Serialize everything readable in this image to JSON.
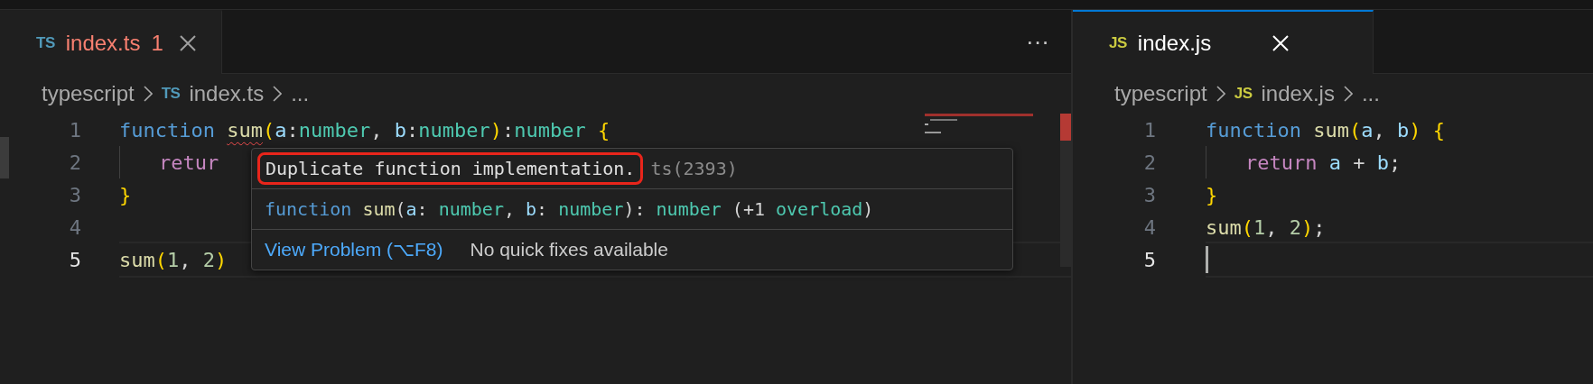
{
  "editor_groups": [
    {
      "focused": false,
      "tabs": [
        {
          "badge": "TS",
          "label": "index.ts",
          "problem_count": "1",
          "has_errors": true,
          "selected": true
        }
      ],
      "more_actions": "···",
      "breadcrumbs": [
        {
          "text": "typescript"
        },
        {
          "text": "index.ts",
          "badge": "TS"
        },
        {
          "text": "..."
        }
      ],
      "lines": [
        {
          "number": "1",
          "current": false,
          "tokens": [
            {
              "text": "function ",
              "kind": "keyword"
            },
            {
              "text": "sum",
              "kind": "function",
              "error": true
            },
            {
              "text": "(",
              "kind": "bracket"
            },
            {
              "text": "a",
              "kind": "param"
            },
            {
              "text": ":",
              "kind": "plain"
            },
            {
              "text": "number",
              "kind": "type"
            },
            {
              "text": ", ",
              "kind": "plain"
            },
            {
              "text": "b",
              "kind": "param"
            },
            {
              "text": ":",
              "kind": "plain"
            },
            {
              "text": "number",
              "kind": "type"
            },
            {
              "text": ")",
              "kind": "bracket"
            },
            {
              "text": ":",
              "kind": "plain"
            },
            {
              "text": "number ",
              "kind": "type"
            },
            {
              "text": "{",
              "kind": "bracket"
            }
          ]
        },
        {
          "number": "2",
          "current": false,
          "indent": true,
          "tokens": [
            {
              "text": "retur",
              "kind": "control"
            }
          ]
        },
        {
          "number": "3",
          "current": false,
          "tokens": [
            {
              "text": "}",
              "kind": "bracket"
            }
          ]
        },
        {
          "number": "4",
          "current": false
        },
        {
          "number": "5",
          "current": true,
          "tokens": [
            {
              "text": "sum",
              "kind": "function"
            },
            {
              "text": "(",
              "kind": "bracket"
            },
            {
              "text": "1",
              "kind": "number"
            },
            {
              "text": ", ",
              "kind": "plain"
            },
            {
              "text": "2",
              "kind": "number"
            },
            {
              "text": ")",
              "kind": "bracket"
            }
          ]
        }
      ],
      "hover": {
        "message": "Duplicate function implementation.",
        "message_highlighted": true,
        "code": "ts(2393)",
        "signature": [
          {
            "text": "function ",
            "kind": "keyword"
          },
          {
            "text": "sum",
            "kind": "function"
          },
          {
            "text": "(",
            "kind": "plain"
          },
          {
            "text": "a",
            "kind": "param"
          },
          {
            "text": ": ",
            "kind": "plain"
          },
          {
            "text": "number",
            "kind": "type"
          },
          {
            "text": ", ",
            "kind": "plain"
          },
          {
            "text": "b",
            "kind": "param"
          },
          {
            "text": ": ",
            "kind": "plain"
          },
          {
            "text": "number",
            "kind": "type"
          },
          {
            "text": "): ",
            "kind": "plain"
          },
          {
            "text": "number",
            "kind": "type"
          },
          {
            "text": " (+1 ",
            "kind": "plain"
          },
          {
            "text": "overload",
            "kind": "type"
          },
          {
            "text": ")",
            "kind": "plain"
          }
        ],
        "action": "View Problem (⌥F8)",
        "note": "No quick fixes available"
      }
    },
    {
      "focused": true,
      "tabs": [
        {
          "badge": "JS",
          "label": "index.js",
          "has_errors": false,
          "selected": true
        }
      ],
      "breadcrumbs": [
        {
          "text": "typescript"
        },
        {
          "text": "index.js",
          "badge": "JS"
        },
        {
          "text": "..."
        }
      ],
      "lines": [
        {
          "number": "1",
          "current": false,
          "tokens": [
            {
              "text": "function ",
              "kind": "keyword"
            },
            {
              "text": "sum",
              "kind": "function"
            },
            {
              "text": "(",
              "kind": "bracket"
            },
            {
              "text": "a",
              "kind": "param"
            },
            {
              "text": ", ",
              "kind": "plain"
            },
            {
              "text": "b",
              "kind": "param"
            },
            {
              "text": ")",
              "kind": "bracket"
            },
            {
              "text": " {",
              "kind": "bracket"
            }
          ]
        },
        {
          "number": "2",
          "current": false,
          "indent": true,
          "tokens": [
            {
              "text": "return ",
              "kind": "control"
            },
            {
              "text": "a",
              "kind": "param"
            },
            {
              "text": " + ",
              "kind": "plain"
            },
            {
              "text": "b",
              "kind": "param"
            },
            {
              "text": ";",
              "kind": "plain"
            }
          ]
        },
        {
          "number": "3",
          "current": false,
          "tokens": [
            {
              "text": "}",
              "kind": "bracket"
            }
          ]
        },
        {
          "number": "4",
          "current": false,
          "tokens": [
            {
              "text": "sum",
              "kind": "function"
            },
            {
              "text": "(",
              "kind": "bracket"
            },
            {
              "text": "1",
              "kind": "number"
            },
            {
              "text": ", ",
              "kind": "plain"
            },
            {
              "text": "2",
              "kind": "number"
            },
            {
              "text": ")",
              "kind": "bracket"
            },
            {
              "text": ";",
              "kind": "plain"
            }
          ]
        },
        {
          "number": "5",
          "current": true,
          "cursor": true
        }
      ]
    }
  ]
}
